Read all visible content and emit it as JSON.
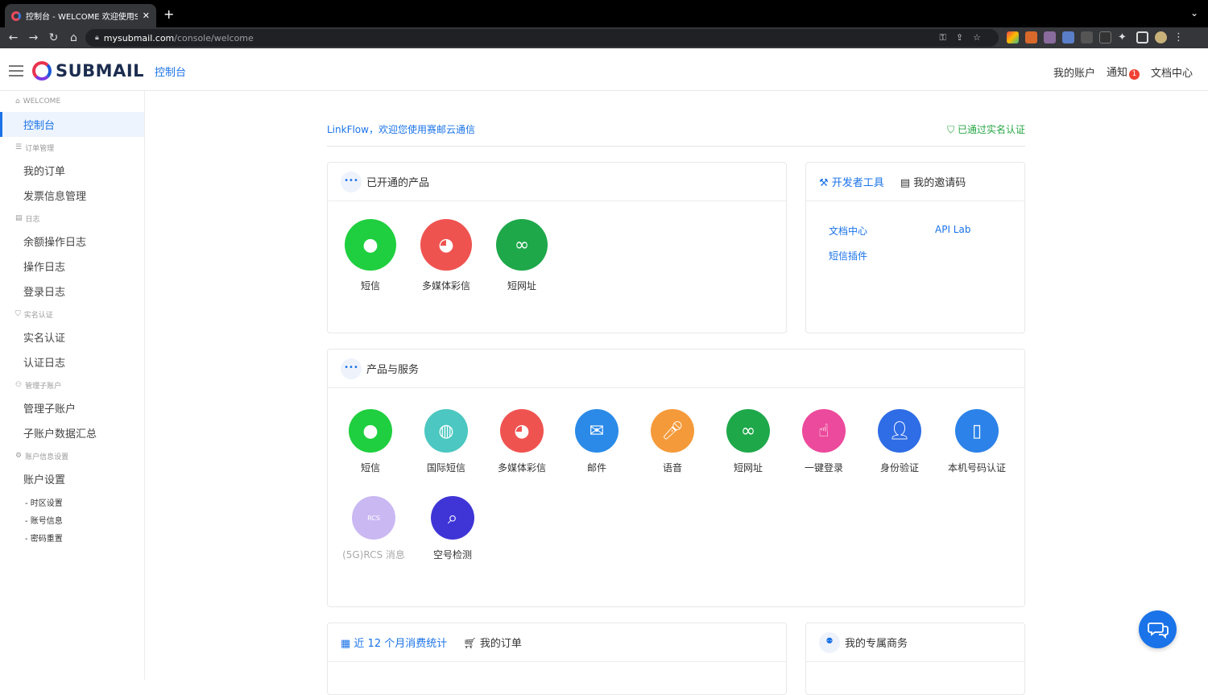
{
  "browser": {
    "tab_title": "控制台 - WELCOME 欢迎使用SU",
    "url_host": "mysubmail.com",
    "url_path": "/console/welcome"
  },
  "header": {
    "brand": "SUBMAIL",
    "breadcrumb": "控制台",
    "nav": [
      "我的账户",
      "通知",
      "文档中心"
    ],
    "notify_count": "1"
  },
  "sidebar": {
    "sections": [
      {
        "title": "WELCOME",
        "items": [
          "控制台"
        ]
      },
      {
        "title": "订单管理",
        "items": [
          "我的订单",
          "发票信息管理"
        ]
      },
      {
        "title": "日志",
        "items": [
          "余额操作日志",
          "操作日志",
          "登录日志"
        ]
      },
      {
        "title": "实名认证",
        "items": [
          "实名认证",
          "认证日志"
        ]
      },
      {
        "title": "管理子账户",
        "items": [
          "管理子账户",
          "子账户数据汇总"
        ]
      },
      {
        "title": "账户信息设置",
        "items": [
          "账户设置"
        ]
      }
    ],
    "subitems": [
      "- 时区设置",
      "- 账号信息",
      "- 密码重置"
    ]
  },
  "welcome": {
    "greeting": "LinkFlow，欢迎您使用赛邮云通信",
    "verified": "已通过实名认证"
  },
  "activated": {
    "title": "已开通的产品",
    "products": [
      "短信",
      "多媒体彩信",
      "短网址"
    ]
  },
  "dev": {
    "tabs": [
      "开发者工具",
      "我的邀请码"
    ],
    "links": [
      "文档中心",
      "API Lab",
      "短信插件"
    ]
  },
  "services": {
    "title": "产品与服务",
    "products": [
      "短信",
      "国际短信",
      "多媒体彩信",
      "邮件",
      "语音",
      "短网址",
      "一键登录",
      "身份验证",
      "本机号码认证",
      "(5G)RCS 消息",
      "空号检测"
    ]
  },
  "stats": {
    "tabs": [
      "近 12 个月消费统计",
      "我的订单"
    ]
  },
  "business": {
    "title": "我的专属商务"
  },
  "colors": {
    "accent": "#1a73e8",
    "success": "#28a745"
  }
}
